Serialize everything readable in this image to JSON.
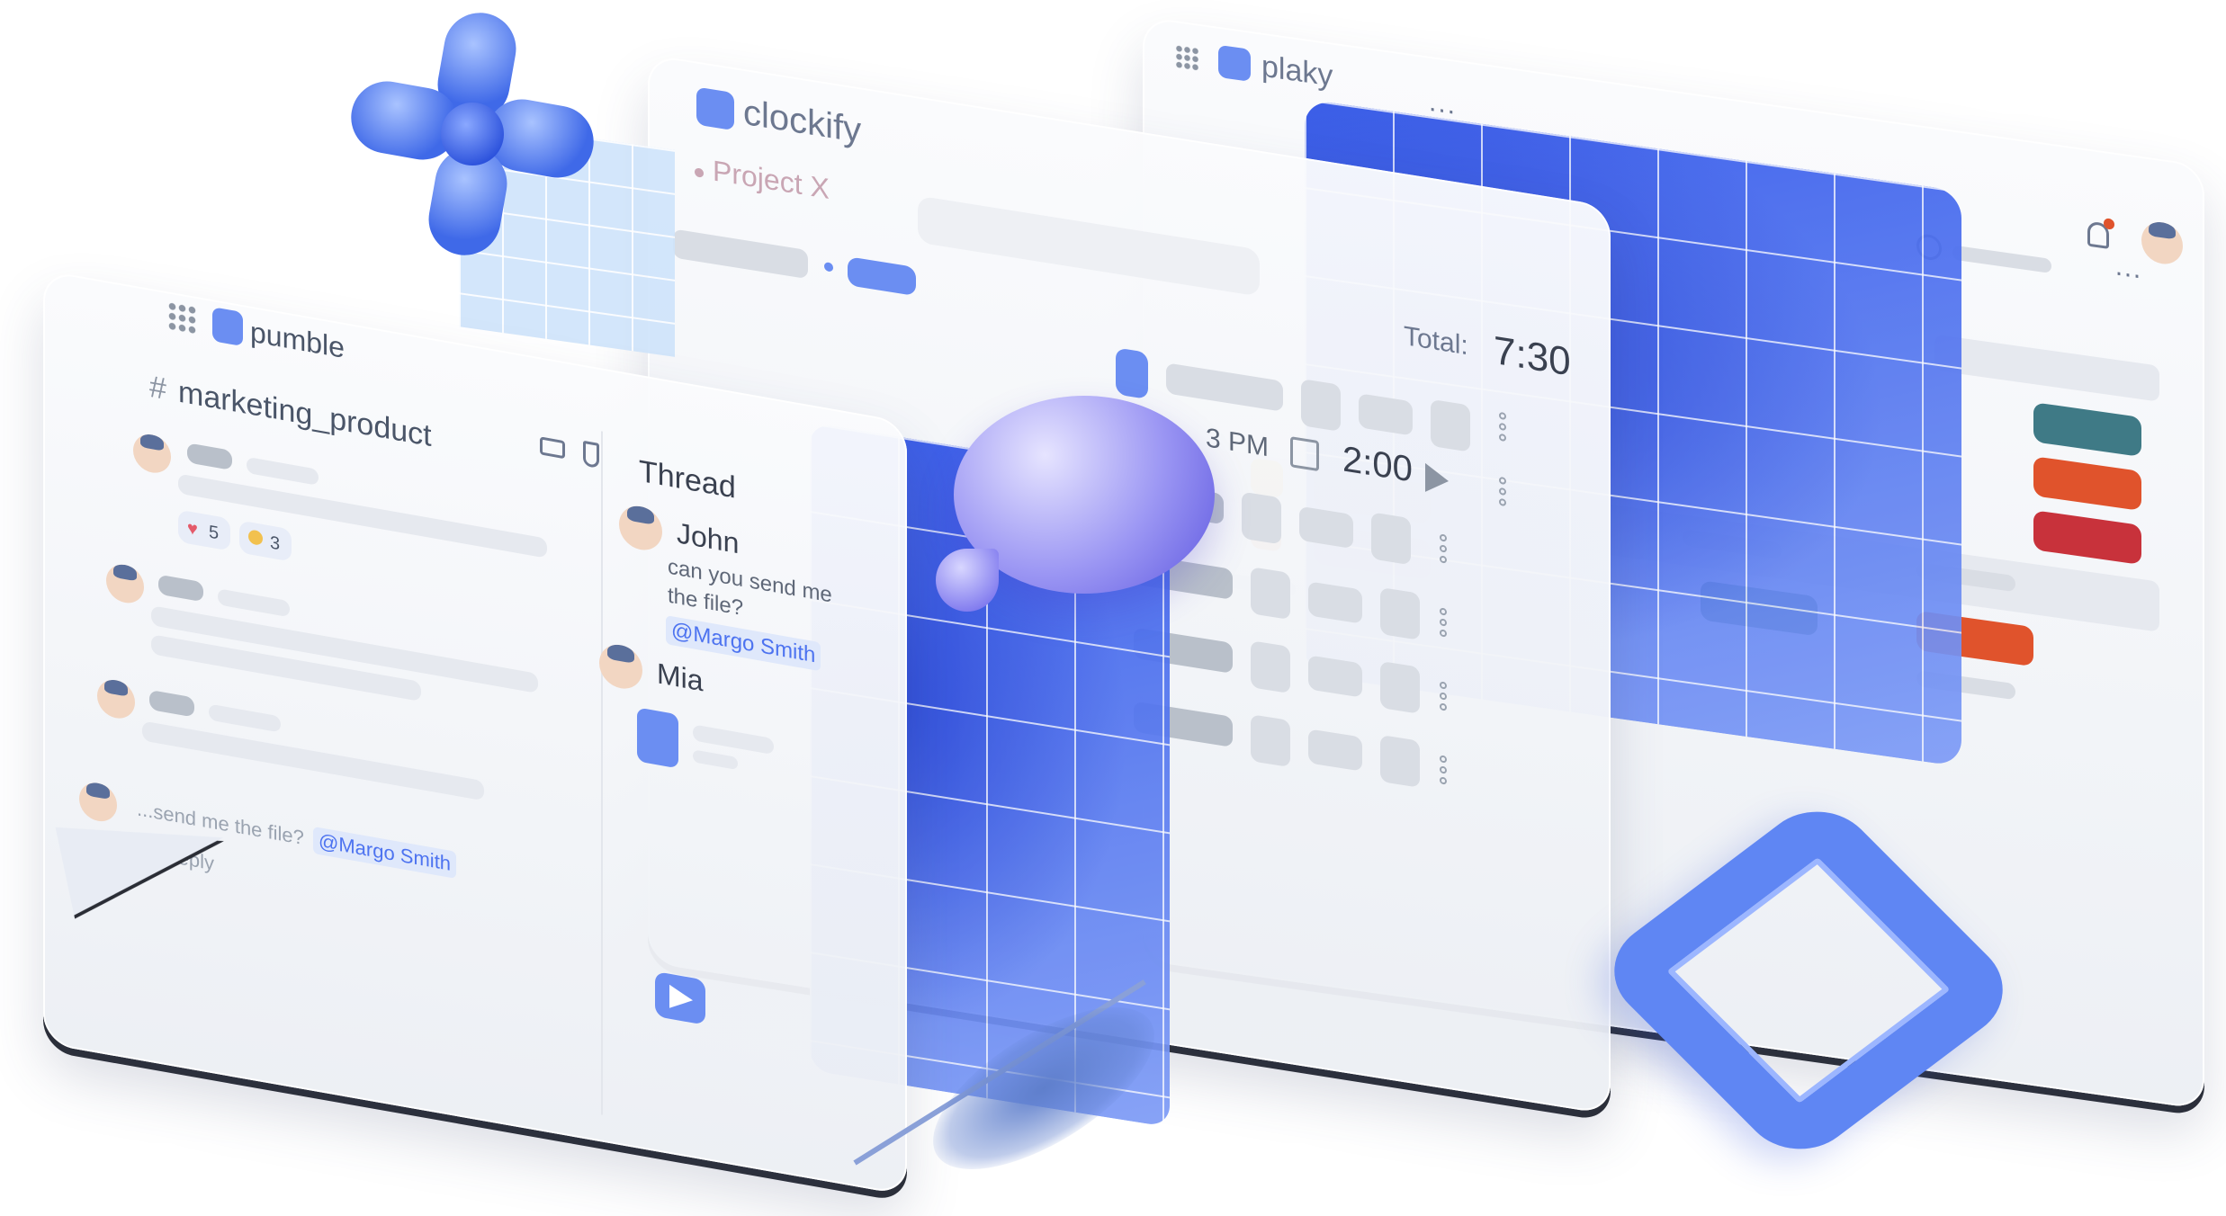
{
  "apps": {
    "plaky": {
      "logo_text": "plaky",
      "more": "..."
    },
    "clockify": {
      "logo_text": "clockify",
      "project_label": "Project X",
      "total_label": "Total:",
      "total_value": "7:30",
      "entry_time_partial": "3 PM",
      "entry_duration": "2:00"
    },
    "pumble": {
      "logo_text": "pumble",
      "channel_hash": "#",
      "channel_name": "marketing_product",
      "reaction_heart_count": "5",
      "reaction_clap_count": "3",
      "thread_title": "Thread",
      "thread_user1": "John",
      "thread_msg_line1": "can you send me",
      "thread_msg_line2": "the file?",
      "thread_mention": "@Margo Smith",
      "thread_user2": "Mia",
      "main_msg_partial": "...send me the file?",
      "main_mention": "@Margo Smith",
      "reply_count": "1 reply"
    }
  },
  "colors": {
    "accent_blue": "#4d73f0",
    "tag_teal": "#3f7a86",
    "tag_orange": "#e0532c",
    "tag_red": "#c8323b",
    "tag_yellow": "#f2c14e",
    "tag_green": "#3d7a6a"
  },
  "icons": [
    "grid-menu-icon",
    "bell-icon",
    "plus-circle-icon",
    "video-icon",
    "phone-icon",
    "calendar-icon",
    "play-icon",
    "file-icon",
    "send-icon",
    "heart-icon",
    "clap-icon",
    "cursor-arrow-icon"
  ]
}
